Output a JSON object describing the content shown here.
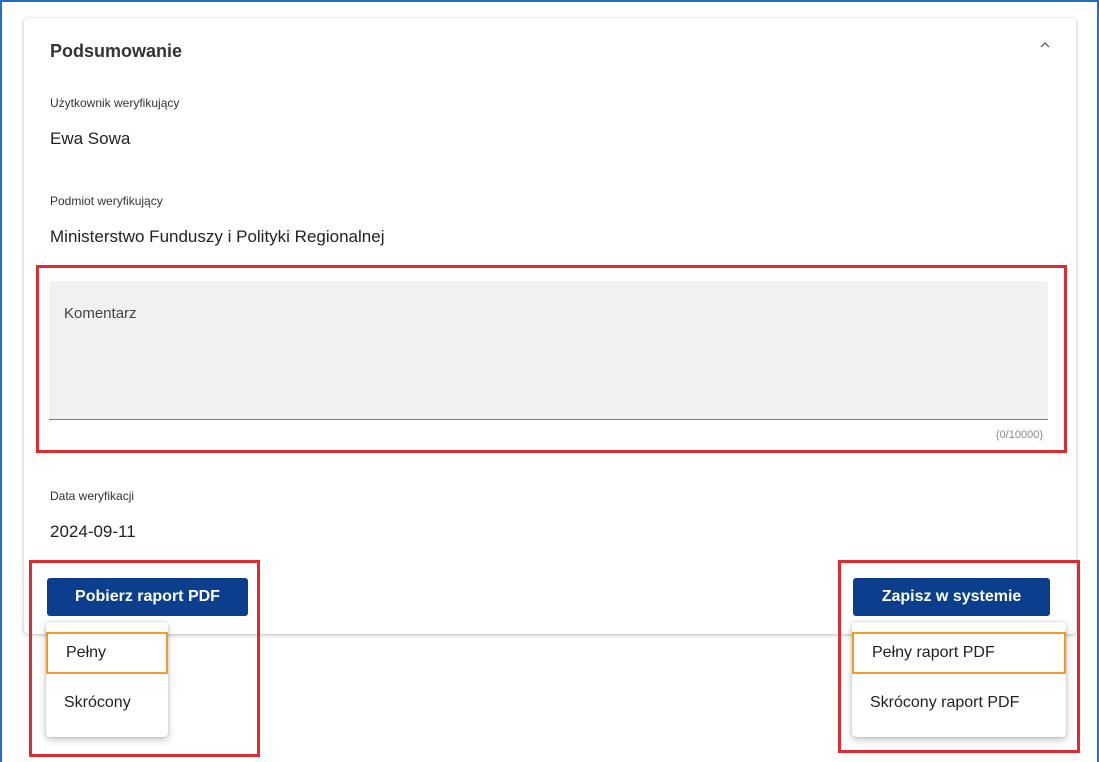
{
  "section": {
    "title": "Podsumowanie"
  },
  "fields": {
    "user_label": "Użytkownik weryfikujący",
    "user_value": "Ewa Sowa",
    "entity_label": "Podmiot weryfikujący",
    "entity_value": "Ministerstwo Funduszy i Polityki Regionalnej",
    "date_label": "Data weryfikacji",
    "date_value": "2024-09-11"
  },
  "comment": {
    "label": "Komentarz",
    "value": "",
    "counter": "(0/10000)"
  },
  "download": {
    "button_label": "Pobierz raport PDF",
    "menu": [
      "Pełny",
      "Skrócony"
    ]
  },
  "save": {
    "button_label": "Zapisz w systemie",
    "menu": [
      "Pełny raport PDF",
      "Skrócony raport PDF"
    ]
  },
  "colors": {
    "primary": "#0b3e8d",
    "highlight": "#e02a2f",
    "focus": "#f39a2d"
  }
}
